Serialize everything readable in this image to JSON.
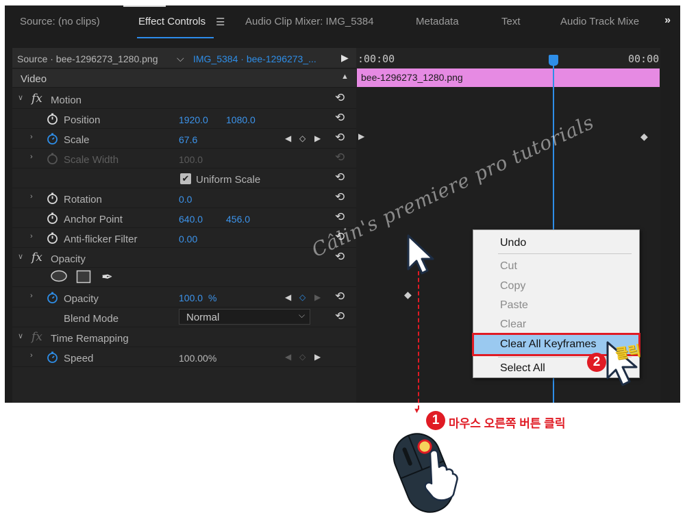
{
  "tabs": [
    {
      "label": "Source: (no clips)"
    },
    {
      "label": "Effect Controls"
    },
    {
      "label": "Audio Clip Mixer: IMG_5384"
    },
    {
      "label": "Metadata"
    },
    {
      "label": "Text"
    },
    {
      "label": "Audio Track Mixe"
    }
  ],
  "source_bar": {
    "source": "Source · bee-1296273_1280.png",
    "clip": "IMG_5384 · bee-1296273_..."
  },
  "timeline": {
    "time_left": ":00:00",
    "time_right": "00:00:",
    "clip_name": "bee-1296273_1280.png"
  },
  "effects": {
    "video_header": "Video",
    "motion": "Motion",
    "position": {
      "label": "Position",
      "x": "1920.0",
      "y": "1080.0"
    },
    "scale": {
      "label": "Scale",
      "value": "67.6"
    },
    "scale_width": {
      "label": "Scale Width",
      "value": "100.0"
    },
    "uniform_scale": "Uniform Scale",
    "rotation": {
      "label": "Rotation",
      "value": "0.0"
    },
    "anchor": {
      "label": "Anchor Point",
      "x": "640.0",
      "y": "456.0"
    },
    "antiflicker": {
      "label": "Anti-flicker Filter",
      "value": "0.00"
    },
    "opacity_header": "Opacity",
    "opacity": {
      "label": "Opacity",
      "value": "100.0",
      "unit": "%"
    },
    "blend": {
      "label": "Blend Mode",
      "value": "Normal"
    },
    "time_remap": "Time Remapping",
    "speed": {
      "label": "Speed",
      "value": "100.00%"
    }
  },
  "context_menu": {
    "undo": "Undo",
    "cut": "Cut",
    "copy": "Copy",
    "paste": "Paste",
    "clear": "Clear",
    "clear_all_keyframes": "Clear All Keyframes",
    "select_all": "Select All"
  },
  "annotations": {
    "step1_num": "1",
    "step1_text": "마우스 오른쪽 버튼 클릭",
    "step2_num": "2",
    "step2_text": "클릭",
    "watermark": "Câlin's premiere pro tutorials"
  },
  "colors": {
    "accent": "#2e8ee8",
    "clip": "#e68ae3",
    "annotation": "#e01b24"
  }
}
